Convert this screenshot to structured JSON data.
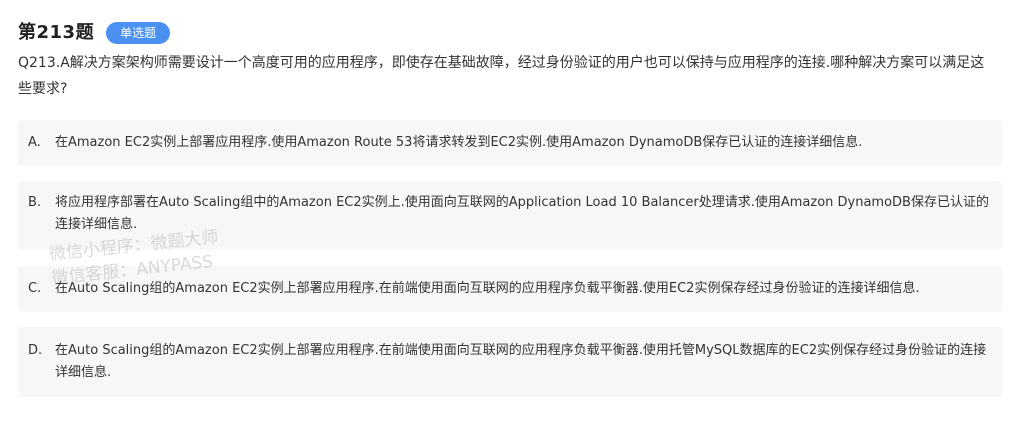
{
  "header": {
    "question_number": "第213题",
    "type_badge": "单选题"
  },
  "question": {
    "text": "Q213.A解决方案架构师需要设计一个高度可用的应用程序，即使存在基础故障，经过身份验证的用户也可以保持与应用程序的连接.哪种解决方案可以满足这些要求?"
  },
  "options": [
    {
      "letter": "A.",
      "text": "在Amazon EC2实例上部署应用程序.使用Amazon Route 53将请求转发到EC2实例.使用Amazon DynamoDB保存已认证的连接详细信息."
    },
    {
      "letter": "B.",
      "text": "将应用程序部署在Auto Scaling组中的Amazon EC2实例上.使用面向互联网的Application Load 10 Balancer处理请求.使用Amazon DynamoDB保存已认证的连接详细信息."
    },
    {
      "letter": "C.",
      "text": "在Auto Scaling组的Amazon EC2实例上部署应用程序.在前端使用面向互联网的应用程序负载平衡器.使用EC2实例保存经过身份验证的连接详细信息."
    },
    {
      "letter": "D.",
      "text": "在Auto Scaling组的Amazon EC2实例上部署应用程序.在前端使用面向互联网的应用程序负载平衡器.使用托管MySQL数据库的EC2实例保存经过身份验证的连接详细信息."
    }
  ],
  "watermark": {
    "line1": "微信小程序：微题大师",
    "line2": "微信客服：ANYPASS"
  }
}
